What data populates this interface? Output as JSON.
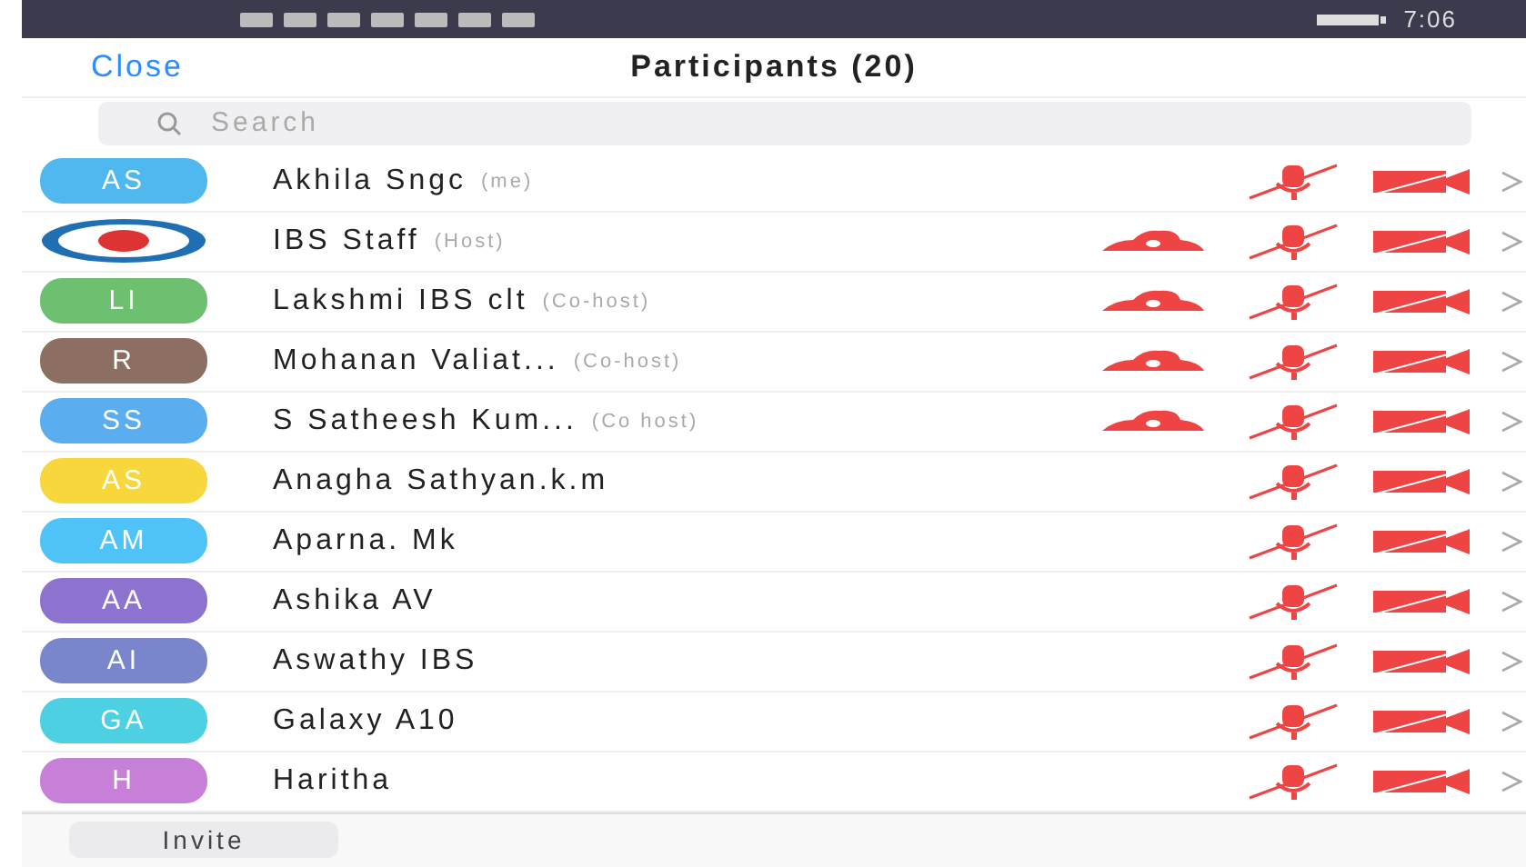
{
  "status_bar": {
    "time": "7:06"
  },
  "header": {
    "close": "Close",
    "title": "Participants (20)"
  },
  "search": {
    "placeholder": "Search"
  },
  "participants": [
    {
      "avatar": {
        "kind": "initials",
        "initials": "AS",
        "color": "#4fb8ee"
      },
      "name": "Akhila Sngc",
      "role": "(me)",
      "recording": false,
      "muted": true,
      "video_off": true
    },
    {
      "avatar": {
        "kind": "logo"
      },
      "name": "IBS Staff",
      "role": "(Host)",
      "recording": true,
      "muted": true,
      "video_off": true
    },
    {
      "avatar": {
        "kind": "initials",
        "initials": "LI",
        "color": "#6cc070"
      },
      "name": "Lakshmi IBS clt",
      "role": "(Co-host)",
      "recording": true,
      "muted": true,
      "video_off": true
    },
    {
      "avatar": {
        "kind": "initials",
        "initials": "R",
        "color": "#8d6e63"
      },
      "name": "Mohanan Valiat...",
      "role": "(Co-host)",
      "recording": true,
      "muted": true,
      "video_off": true
    },
    {
      "avatar": {
        "kind": "initials",
        "initials": "SS",
        "color": "#5aaef0"
      },
      "name": "S Satheesh Kum...",
      "role": "(Co host)",
      "recording": true,
      "muted": true,
      "video_off": true
    },
    {
      "avatar": {
        "kind": "initials",
        "initials": "AS",
        "color": "#f7d73c"
      },
      "name": "Anagha Sathyan.k.m",
      "recording": false,
      "muted": true,
      "video_off": true
    },
    {
      "avatar": {
        "kind": "initials",
        "initials": "AM",
        "color": "#4fc3f7"
      },
      "name": "Aparna. Mk",
      "recording": false,
      "muted": true,
      "video_off": true
    },
    {
      "avatar": {
        "kind": "initials",
        "initials": "AA",
        "color": "#8e72cf"
      },
      "name": "Ashika AV",
      "recording": false,
      "muted": true,
      "video_off": true
    },
    {
      "avatar": {
        "kind": "initials",
        "initials": "AI",
        "color": "#7986cb"
      },
      "name": "Aswathy IBS",
      "recording": false,
      "muted": true,
      "video_off": true
    },
    {
      "avatar": {
        "kind": "initials",
        "initials": "GA",
        "color": "#4dd0e1"
      },
      "name": "Galaxy A10",
      "recording": false,
      "muted": true,
      "video_off": true
    },
    {
      "avatar": {
        "kind": "initials",
        "initials": "H",
        "color": "#c77fd8"
      },
      "name": "Haritha",
      "recording": false,
      "muted": true,
      "video_off": true
    }
  ],
  "footer": {
    "invite": "Invite"
  }
}
